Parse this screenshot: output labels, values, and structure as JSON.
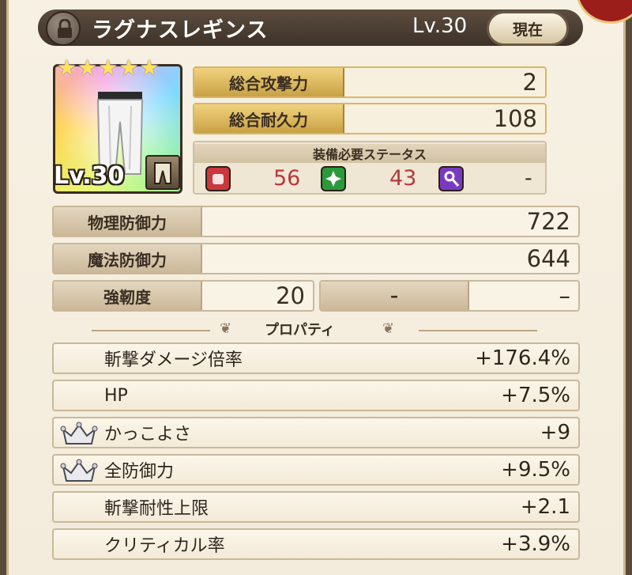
{
  "header": {
    "item_name": "ラグナスレギンス",
    "level": "Lv.30",
    "current_label": "現在"
  },
  "item": {
    "level_label": "Lv.30",
    "stars": [
      "★",
      "★",
      "★",
      "★",
      "★"
    ],
    "star_count": 5,
    "icon": "white-pants-icon",
    "slot_icon": "leg-armor-slot-icon"
  },
  "totals": {
    "attack_label": "総合攻撃力",
    "attack_value": "2",
    "durability_label": "総合耐久力",
    "durability_value": "108"
  },
  "requirements": {
    "title": "装備必要ステータス",
    "items": [
      {
        "icon": "strength-fist-icon",
        "value": "56",
        "color": "#c9383c"
      },
      {
        "icon": "dexterity-star-icon",
        "value": "43",
        "color": "#2a9a3a"
      },
      {
        "icon": "magic-wand-icon",
        "value": "-",
        "color": "#7a3ac0"
      }
    ]
  },
  "defense": {
    "physical_label": "物理防御力",
    "physical_value": "722",
    "magic_label": "魔法防御力",
    "magic_value": "644",
    "toughness_label": "強靭度",
    "toughness_value": "20",
    "extra_value_left": "–",
    "extra_value_right": "–"
  },
  "properties": {
    "title": "プロパティ",
    "rows": [
      {
        "name": "斬撃ダメージ倍率",
        "value": "+176.4%",
        "crown": false
      },
      {
        "name": "HP",
        "value": "+7.5%",
        "crown": false
      },
      {
        "name": "かっこよさ",
        "value": "+9",
        "crown": true
      },
      {
        "name": "全防御力",
        "value": "+9.5%",
        "crown": true
      },
      {
        "name": "斬撃耐性上限",
        "value": "+2.1",
        "crown": false
      },
      {
        "name": "クリティカル率",
        "value": "+3.9%",
        "crown": false
      }
    ]
  },
  "colors": {
    "header_bg": "#4a3c30",
    "panel_bg": "#f5eedf",
    "gold_label": "#dcb85e",
    "requirement_value": "#b53a3e"
  }
}
